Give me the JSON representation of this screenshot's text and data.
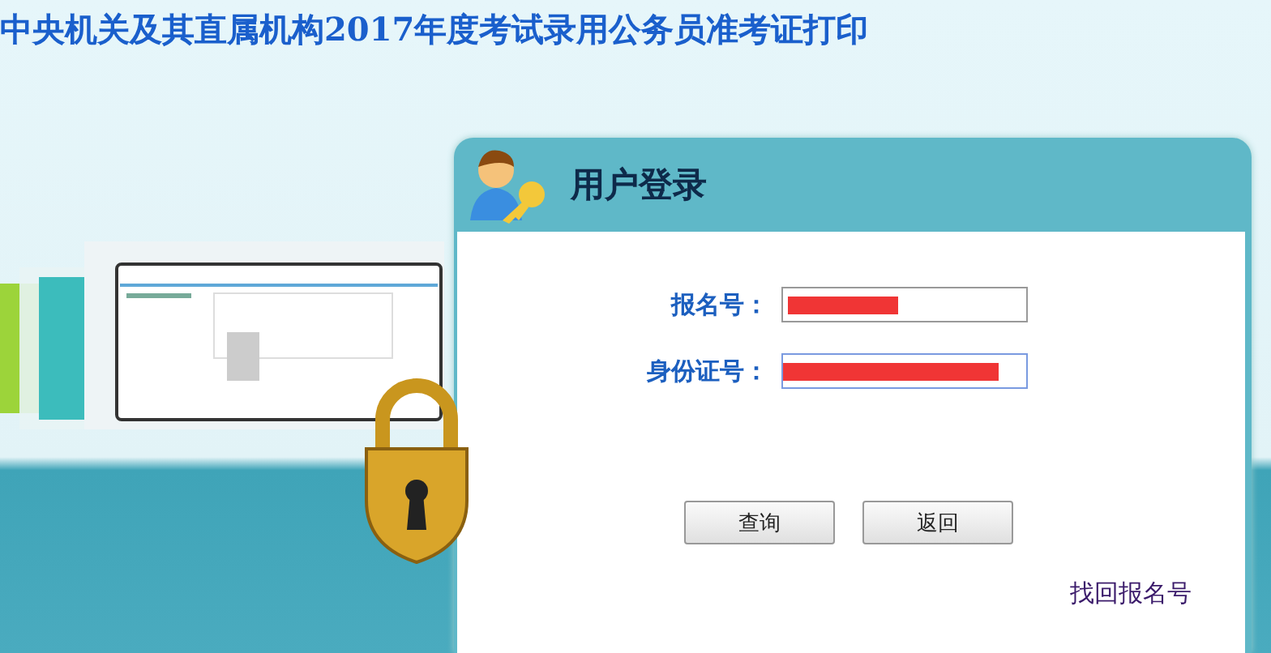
{
  "page_title": "中央机关及其直属机构2017年度考试录用公务员准考证打印",
  "login_panel": {
    "title": "用户登录",
    "fields": [
      {
        "label": "报名号：",
        "redacted": true,
        "focused": false
      },
      {
        "label": "身份证号：",
        "redacted": true,
        "focused": true
      }
    ],
    "buttons": [
      "查询",
      "返回"
    ],
    "link": "找回报名号"
  }
}
